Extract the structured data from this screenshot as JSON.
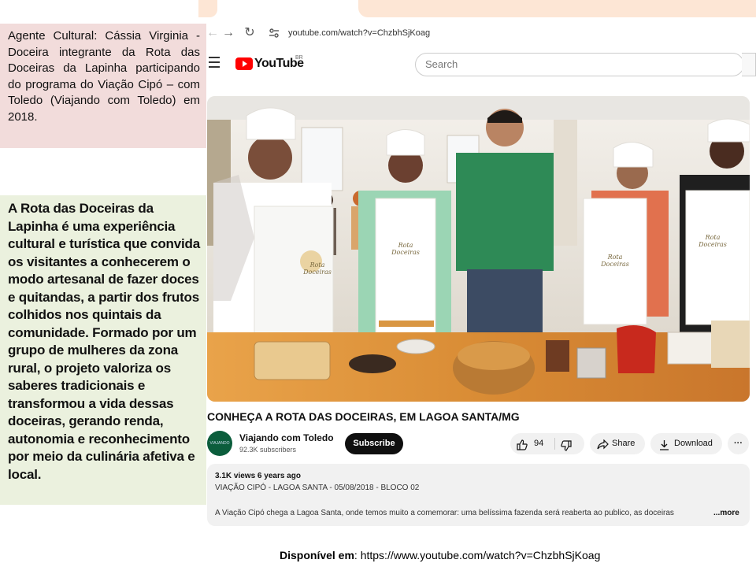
{
  "captions": {
    "top": "Agente Cultural: Cássia Virginia - Doceira integrante da Rota das Doceiras da Lapinha participando do programa do Viação Cipó – com Toledo (Viajando com Toledo) em 2018.",
    "description": "A Rota das Doceiras da Lapinha é uma experiência cultural e turística que convida os visitantes a conhecerem o modo artesanal de fazer doces e quitandas, a partir dos frutos colhidos nos quintais da comunidade. Formado por um grupo de mulheres da zona rural, o projeto valoriza os saberes tradicionais e transformou a vida dessas doceiras, gerando renda, autonomia e reconhecimento por meio da culinária afetiva e local."
  },
  "browser": {
    "url": "youtube.com/watch?v=ChzbhSjKoag"
  },
  "youtube": {
    "logo_text": "YouTube",
    "country_code": "BR",
    "search_placeholder": "Search",
    "video_title": "CONHEÇA A ROTA DAS DOCEIRAS, EM LAGOA SANTA/MG",
    "channel": {
      "name": "Viajando com Toledo",
      "subscribers": "92.3K subscribers",
      "avatar_text": "VIAJANDO COM TOLEDO"
    },
    "subscribe_label": "Subscribe",
    "likes": "94",
    "share_label": "Share",
    "download_label": "Download",
    "more_options": "···",
    "description": {
      "meta": "3.1K views  6 years ago",
      "tags": "VIAÇÃO CIPÓ - LAGOA SANTA - 05/08/2018 - BLOCO 02",
      "text": "A Viação Cipó chega a Lagoa Santa, onde temos muito a comemorar: uma belíssima fazenda será reaberta ao publico, as doceiras",
      "more_label": "...more"
    },
    "apron_text": "Rota Doceiras"
  },
  "source": {
    "label": "Disponível em",
    "url": "https://www.youtube.com/watch?v=ChzbhSjKoag"
  },
  "colors": {
    "caption_pink": "#f2dcdb",
    "caption_green": "#ebf1de",
    "youtube_red": "#ff0000",
    "tab_peach": "#fde6d5"
  }
}
